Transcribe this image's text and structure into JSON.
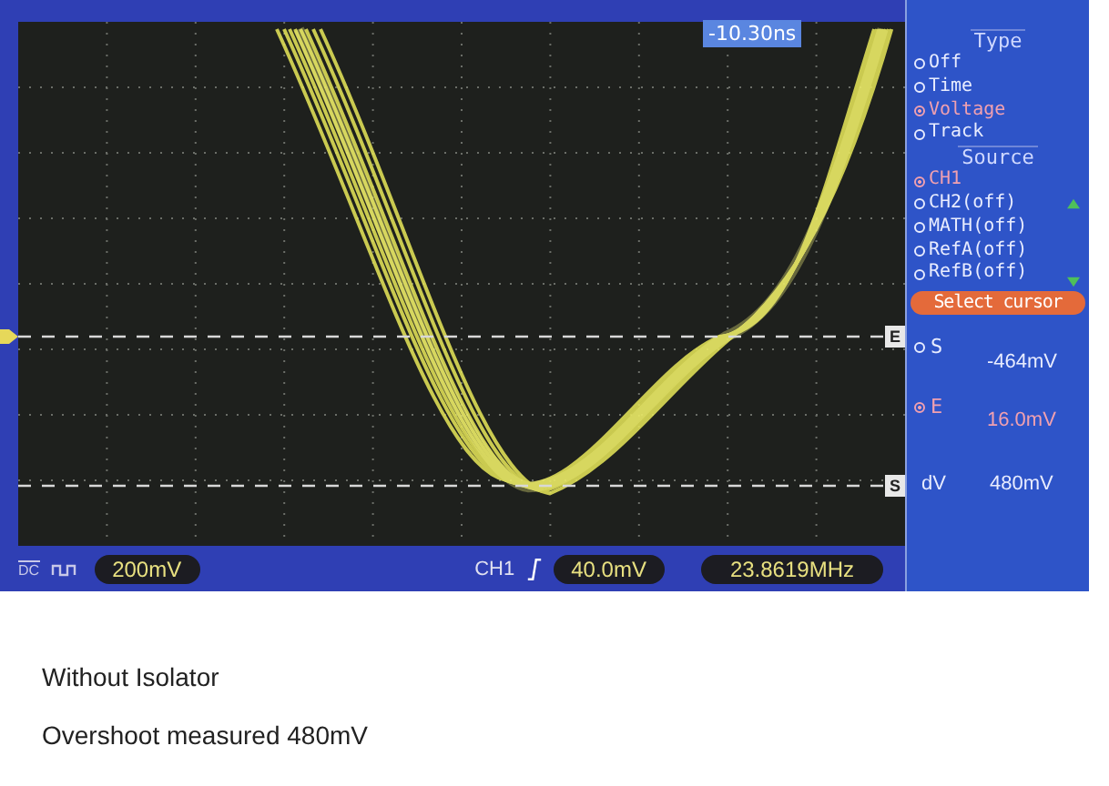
{
  "timebase_marker": "-10.30ns",
  "cursor_markers": [
    {
      "label": "E"
    },
    {
      "label": "S"
    }
  ],
  "menu": {
    "sections": [
      {
        "title": "Type",
        "options": [
          {
            "label": "Off",
            "selected": false
          },
          {
            "label": "Time",
            "selected": false
          },
          {
            "label": "Voltage",
            "selected": true
          },
          {
            "label": "Track",
            "selected": false
          }
        ]
      },
      {
        "title": "Source",
        "options": [
          {
            "label": "CH1",
            "selected": true
          },
          {
            "label": "CH2(off)",
            "selected": false
          },
          {
            "label": "MATH(off)",
            "selected": false
          },
          {
            "label": "RefA(off)",
            "selected": false
          },
          {
            "label": "RefB(off)",
            "selected": false
          }
        ]
      }
    ],
    "select_label": "Select cursor",
    "cursors": [
      {
        "label": "S",
        "value": "-464mV",
        "selected": false
      },
      {
        "label": "E",
        "value": "16.0mV",
        "selected": true
      }
    ],
    "delta": {
      "label": "dV",
      "value": "480mV"
    }
  },
  "status_bar": {
    "coupling": "DC",
    "volts_div": "200mV",
    "channel": "CH1",
    "trigger_level": "40.0mV",
    "frequency": "23.8619MHz"
  },
  "caption": {
    "title": "Without Isolator",
    "text": "Overshoot measured 480mV"
  }
}
